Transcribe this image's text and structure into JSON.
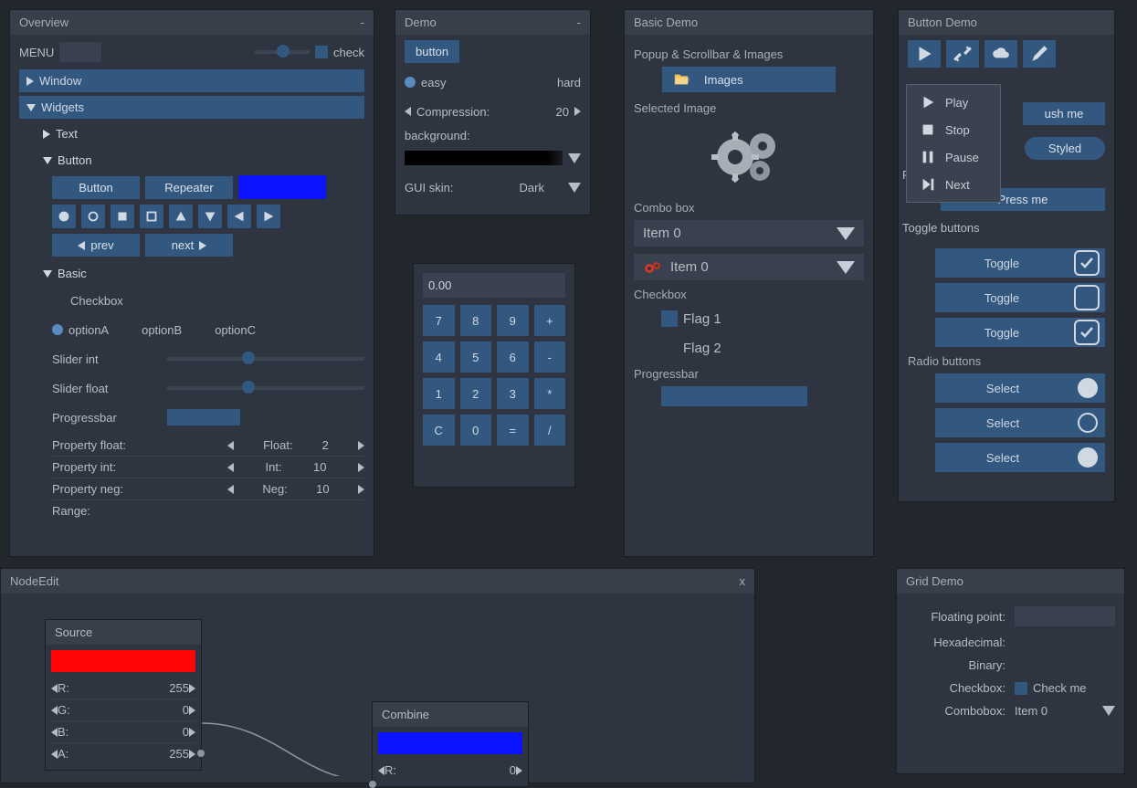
{
  "overview": {
    "title": "Overview",
    "menu_label": "MENU",
    "check_label": "check",
    "items": {
      "window": "Window",
      "widgets": "Widgets",
      "text": "Text",
      "button": "Button",
      "basic": "Basic",
      "checkbox": "Checkbox",
      "range": "Range:"
    },
    "button_btn": "Button",
    "repeater_btn": "Repeater",
    "prev": "prev",
    "next": "next",
    "optionA": "optionA",
    "optionB": "optionB",
    "optionC": "optionC",
    "slider_int": "Slider int",
    "slider_float": "Slider float",
    "progressbar_label": "Progressbar",
    "props": [
      {
        "label": "Property float:",
        "name": "Float:",
        "val": "2"
      },
      {
        "label": "Property int:",
        "name": "Int:",
        "val": "10"
      },
      {
        "label": "Property neg:",
        "name": "Neg:",
        "val": "10"
      }
    ]
  },
  "demo": {
    "title": "Demo",
    "button": "button",
    "easy": "easy",
    "hard": "hard",
    "compression": "Compression:",
    "compression_val": "20",
    "background": "background:",
    "gui_skin": "GUI skin:",
    "skin_val": "Dark"
  },
  "calc": {
    "display": "0.00",
    "keys": [
      "7",
      "8",
      "9",
      "+",
      "4",
      "5",
      "6",
      "-",
      "1",
      "2",
      "3",
      "*",
      "C",
      "0",
      "=",
      "/"
    ]
  },
  "basic": {
    "title": "Basic Demo",
    "popup_label": "Popup & Scrollbar & Images",
    "images_btn": "Images",
    "selected_image": "Selected Image",
    "combo_label": "Combo box",
    "combo1": "Item 0",
    "combo2": "Item 0",
    "checkbox_label": "Checkbox",
    "flag1": "Flag 1",
    "flag2": "Flag 2",
    "progressbar": "Progressbar"
  },
  "button_demo": {
    "title": "Button Demo",
    "push_me": "ush me",
    "styled": "Styled",
    "repeater": "Repeater",
    "press_me": "Press me",
    "toggle_header": "Toggle buttons",
    "toggle": "Toggle",
    "radio_header": "Radio buttons",
    "select": "Select",
    "menu": [
      "Play",
      "Stop",
      "Pause",
      "Next"
    ]
  },
  "node_edit": {
    "title": "NodeEdit",
    "close": "x",
    "source": {
      "title": "Source",
      "r_label": "R:",
      "r_val": "255",
      "g_label": "G:",
      "g_val": "0",
      "b_label": "B:",
      "b_val": "0",
      "a_label": "A:",
      "a_val": "255"
    },
    "combine": {
      "title": "Combine",
      "r_label": "R:",
      "r_val": "0"
    }
  },
  "grid": {
    "title": "Grid Demo",
    "floating": "Floating point:",
    "hex": "Hexadecimal:",
    "binary": "Binary:",
    "checkbox": "Checkbox:",
    "check_me": "Check me",
    "combobox": "Combobox:",
    "combo_val": "Item 0"
  }
}
